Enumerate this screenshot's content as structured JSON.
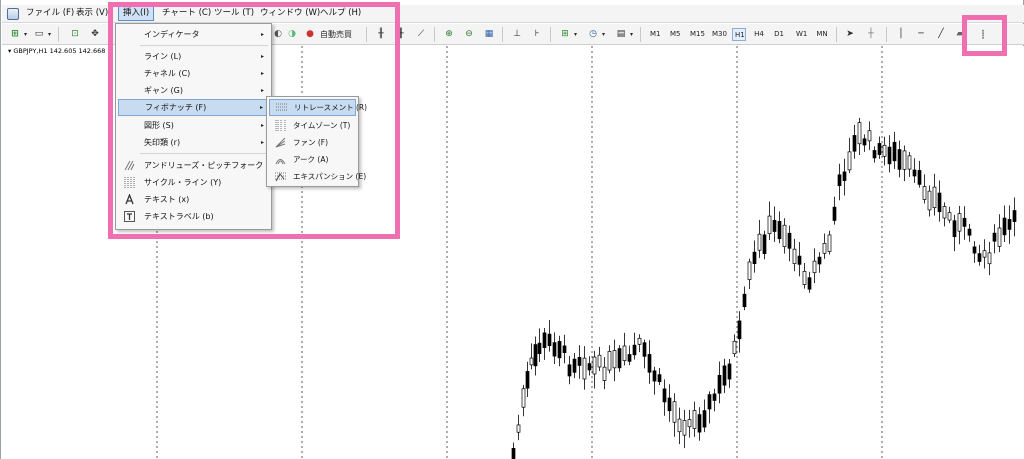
{
  "menubar": {
    "items": [
      {
        "label": "ファイル (F)"
      },
      {
        "label": "表示 (V)"
      },
      {
        "label": "挿入(I)"
      },
      {
        "label": "チャート (C)"
      },
      {
        "label": "ツール (T)"
      },
      {
        "label": "ウィンドウ (W)"
      },
      {
        "label": "ヘルプ (H)"
      }
    ]
  },
  "toolbar": {
    "auto_trade_label": "自動売買",
    "timeframes": [
      "M1",
      "M5",
      "M15",
      "M30",
      "H1",
      "H4",
      "D1",
      "W1",
      "MN"
    ],
    "active_timeframe": "H1"
  },
  "chart": {
    "symbol_label": "GBPJPY,H1  142.605 142.668"
  },
  "insert_menu": {
    "items": [
      {
        "label": "インディケータ",
        "submenu": true
      },
      {
        "label": "ライン (L)",
        "submenu": true
      },
      {
        "label": "チャネル (C)",
        "submenu": true
      },
      {
        "label": "ギャン (G)",
        "submenu": true
      },
      {
        "label": "フィボナッチ (F)",
        "submenu": true
      },
      {
        "label": "図形 (S)",
        "submenu": true
      },
      {
        "label": "矢印類 (r)",
        "submenu": true
      },
      {
        "label": "アンドリューズ・ピッチフォーク (A)",
        "submenu": false
      },
      {
        "label": "サイクル・ライン (Y)",
        "submenu": false
      },
      {
        "label": "テキスト (x)",
        "submenu": false
      },
      {
        "label": "テキストラベル (b)",
        "submenu": false
      }
    ],
    "arrow": "▸"
  },
  "fibonacci_menu": {
    "items": [
      {
        "label": "リトレースメント (R)"
      },
      {
        "label": "タイムゾーン (T)"
      },
      {
        "label": "ファン (F)"
      },
      {
        "label": "アーク (A)"
      },
      {
        "label": "エキスパンション (E)"
      }
    ]
  },
  "colors": {
    "highlight_pink": "#ef6fb1",
    "menu_highlight": "#c7dcf1",
    "candle_bull": "#ffffff",
    "candle_bear": "#000000"
  }
}
